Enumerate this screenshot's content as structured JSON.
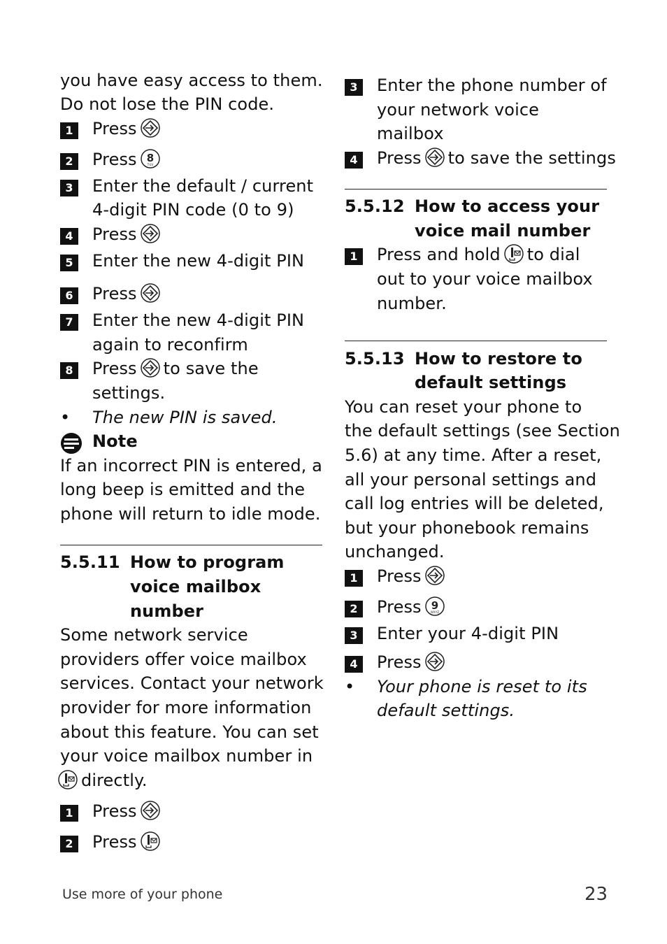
{
  "left": {
    "intro": [
      "you have easy access to them.",
      "Do not lose the PIN code."
    ],
    "steps_a": [
      {
        "n": "1",
        "text": "Press",
        "icon": "ok-nav-key-icon"
      },
      {
        "n": "2",
        "text": "Press",
        "icon": "key-8-icon"
      },
      {
        "n": "3",
        "text": "Enter the default / current",
        "text2": "4-digit PIN code (0 to 9)"
      },
      {
        "n": "4",
        "text": "Press",
        "icon": "ok-nav-key-icon"
      },
      {
        "n": "5",
        "text": "Enter the new 4-digit PIN"
      },
      {
        "n": "6",
        "text": "Press",
        "icon": "ok-nav-key-icon"
      },
      {
        "n": "7",
        "text": "Enter the new 4-digit PIN",
        "text2": "again to reconfirm"
      },
      {
        "n": "8",
        "text": "Press",
        "after": "to save the",
        "text2": "settings."
      }
    ],
    "result": "The new PIN is saved.",
    "note_title": "Note",
    "note_text": [
      "If an incorrect PIN is entered, a",
      "long beep is emitted and the",
      "phone will return to idle mode."
    ],
    "section_num": "5.5.11",
    "section_title": [
      "How to program",
      "voice mailbox",
      "number"
    ],
    "body": [
      "Some network service",
      "providers offer voice mailbox",
      "services. Contact your network",
      "provider for more information",
      "about this feature. You can set",
      "your voice mailbox number in"
    ],
    "body_end": "directly.",
    "steps_b": [
      {
        "n": "1",
        "text": "Press"
      },
      {
        "n": "2",
        "text": "Press"
      }
    ]
  },
  "right": {
    "steps_a": [
      {
        "n": "3",
        "text": "Enter the phone number of",
        "text2": "your network voice",
        "text3": "mailbox"
      },
      {
        "n": "4",
        "text": "Press",
        "after": "to save the settings"
      }
    ],
    "s12_num": "5.5.12",
    "s12_title": [
      "How to access your",
      "voice mail number"
    ],
    "s12_step": {
      "n": "1",
      "text": "Press and hold",
      "after": "to dial",
      "text2": "out to your voice mailbox",
      "text3": "number."
    },
    "s13_num": "5.5.13",
    "s13_title": [
      "How to restore to",
      "default settings"
    ],
    "s13_body": [
      "You can reset your phone to",
      "the default settings (see Section",
      "5.6) at any time. After a reset,",
      "all your personal settings and",
      "call log entries will be deleted,",
      "but your phonebook remains",
      "unchanged."
    ],
    "steps_b": [
      {
        "n": "1",
        "text": "Press"
      },
      {
        "n": "2",
        "text": "Press"
      },
      {
        "n": "3",
        "text": "Enter your 4-digit PIN"
      },
      {
        "n": "4",
        "text": "Press"
      }
    ],
    "result": [
      "Your phone is reset to its",
      "default settings."
    ]
  },
  "footer": {
    "section": "Use more of your phone",
    "page": "23"
  }
}
